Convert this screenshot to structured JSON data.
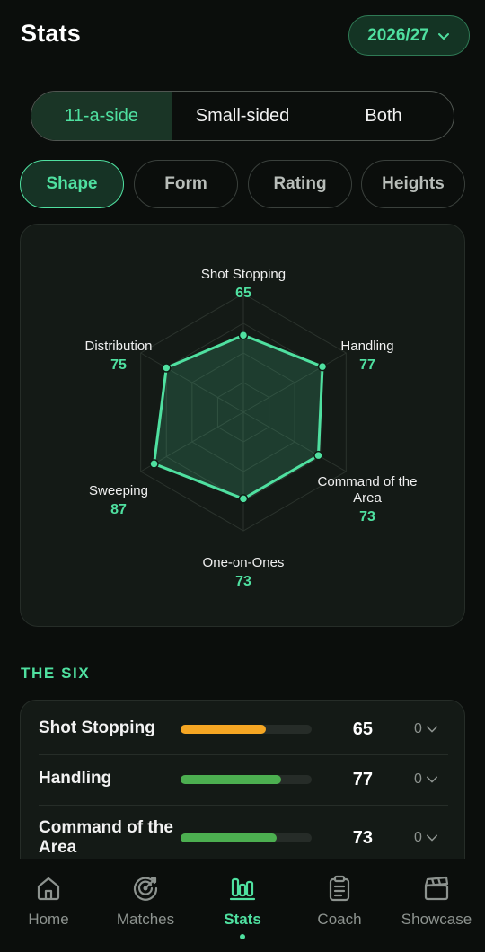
{
  "header": {
    "title": "Stats",
    "season": "2026/27"
  },
  "format_toggle": {
    "options": [
      "11-a-side",
      "Small-sided",
      "Both"
    ],
    "selected": "11-a-side"
  },
  "tabs": [
    {
      "label": "Shape",
      "active": true
    },
    {
      "label": "Form",
      "active": false
    },
    {
      "label": "Rating",
      "active": false
    },
    {
      "label": "Heights",
      "active": false
    }
  ],
  "radar": {
    "max": 100,
    "axes": [
      {
        "label": "Shot Stopping",
        "value": 65
      },
      {
        "label": "Handling",
        "value": 77
      },
      {
        "label": "Command of the Area",
        "value": 73
      },
      {
        "label": "One-on-Ones",
        "value": 73
      },
      {
        "label": "Sweeping",
        "value": 87
      },
      {
        "label": "Distribution",
        "value": 75
      }
    ]
  },
  "the_six": {
    "title": "THE SIX",
    "rows": [
      {
        "name": "Shot Stopping",
        "score": 65,
        "delta": "0",
        "bar_color": "#f5a623",
        "fill_fraction": 0.65
      },
      {
        "name": "Handling",
        "score": 77,
        "delta": "0",
        "bar_color": "#4caf50",
        "fill_fraction": 0.77
      },
      {
        "name": "Command of the Area",
        "score": 73,
        "delta": "0",
        "bar_color": "#4caf50",
        "fill_fraction": 0.73
      }
    ]
  },
  "nav": {
    "items": [
      {
        "label": "Home",
        "icon": "home-icon",
        "active": false
      },
      {
        "label": "Matches",
        "icon": "matches-icon",
        "active": false
      },
      {
        "label": "Stats",
        "icon": "stats-icon",
        "active": true
      },
      {
        "label": "Coach",
        "icon": "coach-icon",
        "active": false
      },
      {
        "label": "Showcase",
        "icon": "showcase-icon",
        "active": false
      }
    ]
  },
  "colors": {
    "accent": "#4fe0a0",
    "background": "#0b0e0c",
    "card": "#141a16",
    "bar_warning": "#f5a623",
    "bar_good": "#4caf50"
  }
}
